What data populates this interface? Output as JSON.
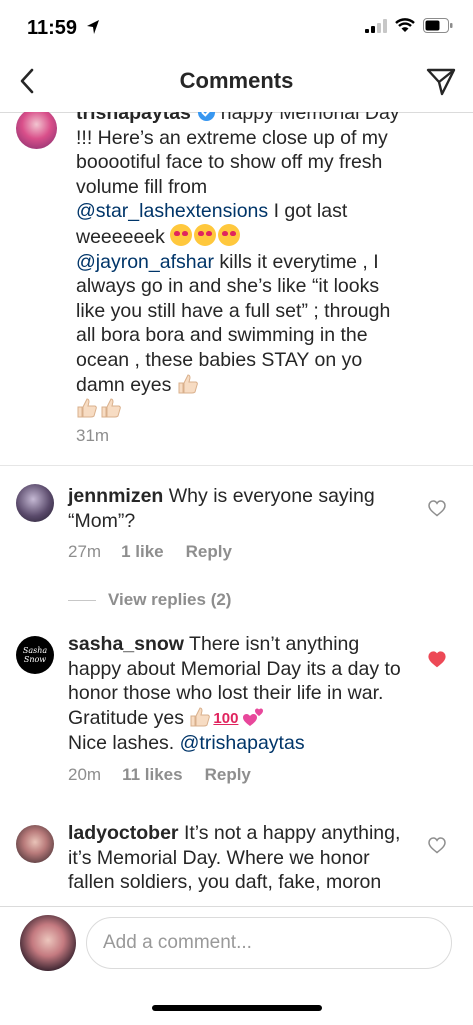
{
  "status": {
    "time": "11:59"
  },
  "nav": {
    "title": "Comments"
  },
  "caption": {
    "username": "trishapaytas",
    "text1": " happy Memorial Day !!! Here’s an extreme close up of my booootiful face to show off my fresh volume fill from ",
    "mention1": "@star_lashextensions",
    "text2": " I got last weeeeeek ",
    "mention2": "@jayron_afshar",
    "text3": " kills it everytime , I always go in and she’s like “it looks like you still have a full set” ; through all bora bora and swimming in the ocean , these babies STAY on yo damn eyes ",
    "time": "31m",
    "emoji": {
      "heart_eyes": "heart-eyes-emoji",
      "thumbs": "thumbs-up-emoji"
    }
  },
  "comments": [
    {
      "username": "jennmizen",
      "text": " Why is everyone saying “Mom”?",
      "time": "27m",
      "likes": "1 like",
      "reply": "Reply",
      "liked": false,
      "view_replies": "View replies (2)"
    },
    {
      "username": "sasha_snow",
      "text": " There isn’t anything happy about Memorial Day its a day to honor those who lost their life in war. Gratitude yes ",
      "text_end": "Nice lashes. ",
      "mention": "@trishapaytas",
      "time": "20m",
      "likes": "11 likes",
      "reply": "Reply",
      "liked": true,
      "avatar_text": "Sasha Snow"
    },
    {
      "username": "ladyoctober",
      "text": " It’s not a happy anything, it’s Memorial Day. Where we honor fallen soldiers, you daft, fake, moron",
      "liked": false
    }
  ],
  "composer": {
    "placeholder": "Add a comment..."
  },
  "colors": {
    "liked_heart": "#ed4956",
    "mention": "#003569",
    "verified": "#3897f0"
  }
}
